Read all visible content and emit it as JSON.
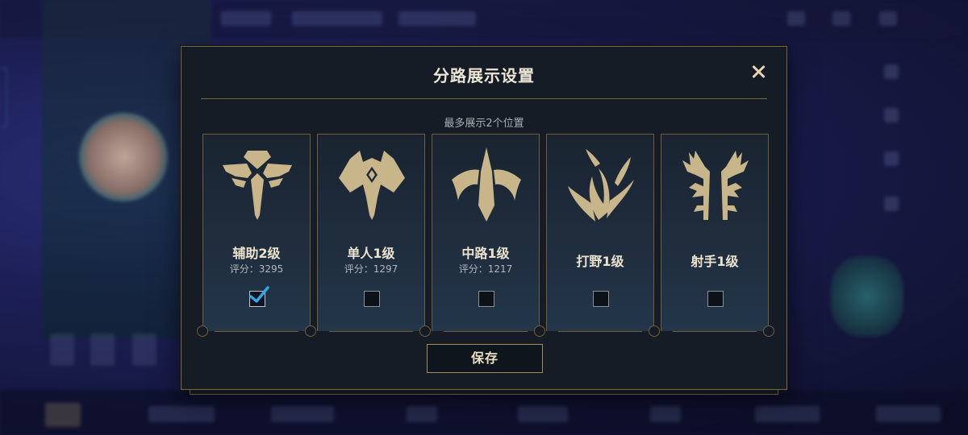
{
  "dialog": {
    "title": "分路展示设置",
    "subtitle": "最多展示2个位置",
    "save_label": "保存"
  },
  "colors": {
    "accent_gold": "#c9b58a",
    "check_blue": "#33a8e8",
    "panel_bg": "#151c26",
    "border_gold": "#7e6a3f"
  },
  "lanes": [
    {
      "name": "辅助2级",
      "score": "评分：3295",
      "checked": true,
      "icon": "support-lane-icon"
    },
    {
      "name": "单人1级",
      "score": "评分：1297",
      "checked": false,
      "icon": "solo-lane-icon"
    },
    {
      "name": "中路1级",
      "score": "评分：1217",
      "checked": false,
      "icon": "mid-lane-icon"
    },
    {
      "name": "打野1级",
      "score": "",
      "checked": false,
      "icon": "jungle-icon"
    },
    {
      "name": "射手1级",
      "score": "",
      "checked": false,
      "icon": "marksman-icon"
    }
  ]
}
